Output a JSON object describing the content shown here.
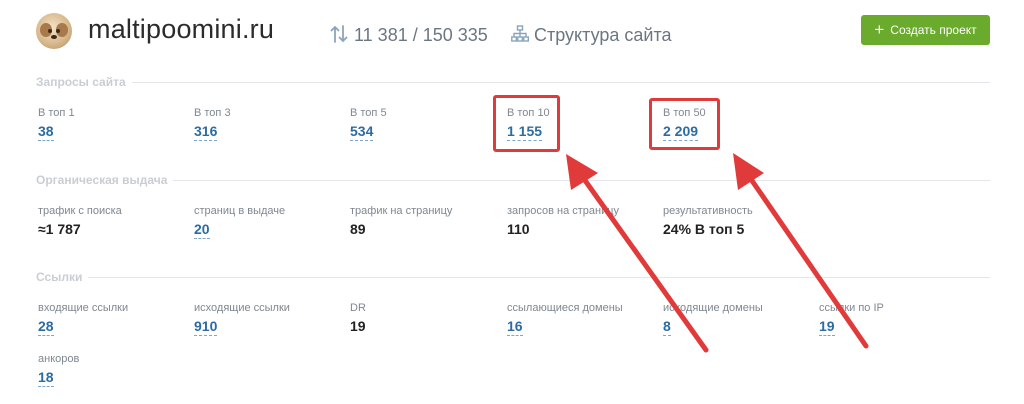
{
  "header": {
    "avatar": "maltipoo-dog-avatar",
    "site": "maltipoomini.ru",
    "sort_icon": "sort-arrows-icon",
    "counts": "11 381 / 150 335",
    "structure_icon": "sitemap-icon",
    "structure_label": "Структура сайта",
    "create_button": "Создать проект",
    "create_icon": "plus-icon",
    "accent_color": "#6aaa2d"
  },
  "sections": {
    "queries": {
      "title": "Запросы сайта",
      "items": [
        {
          "label": "В топ 1",
          "value": "38"
        },
        {
          "label": "В топ 3",
          "value": "316"
        },
        {
          "label": "В топ 5",
          "value": "534"
        },
        {
          "label": "В топ 10",
          "value": "1 155"
        },
        {
          "label": "В топ 50",
          "value": "2 209"
        }
      ]
    },
    "organic": {
      "title": "Органическая выдача",
      "items": [
        {
          "label": "трафик с поиска",
          "value": "≈1 787"
        },
        {
          "label": "страниц в выдаче",
          "value": "20"
        },
        {
          "label": "трафик на страницу",
          "value": "89"
        },
        {
          "label": "запросов на страницу",
          "value": "110"
        },
        {
          "label": "результативность",
          "value": "24% В топ 5"
        }
      ]
    },
    "links": {
      "title": "Ссылки",
      "items": [
        {
          "label": "входящие ссылки",
          "value": "28"
        },
        {
          "label": "исходящие ссылки",
          "value": "910"
        },
        {
          "label": "DR",
          "value": "19"
        },
        {
          "label": "ссылающиеся домены",
          "value": "16"
        },
        {
          "label": "исходящие домены",
          "value": "8"
        },
        {
          "label": "ссылки по IP",
          "value": "19"
        },
        {
          "label": "анкоров",
          "value": "18"
        }
      ]
    }
  },
  "annotation_color": "#e03a3a"
}
